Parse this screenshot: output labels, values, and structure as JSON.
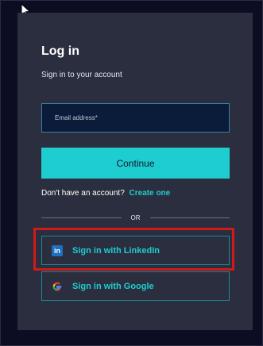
{
  "login": {
    "title": "Log in",
    "subtitle": "Sign in to your account",
    "email_placeholder": "Email address*",
    "email_value": "",
    "continue_label": "Continue",
    "no_account_text": "Don't have an account?",
    "create_link": "Create one",
    "divider_text": "OR"
  },
  "social": {
    "linkedin_label": "Sign in with LinkedIn",
    "google_label": "Sign in with Google",
    "linkedin_icon": "li-icon",
    "google_icon": "google-g-icon"
  },
  "colors": {
    "page_bg": "#0c0c22",
    "card_bg": "#2b2e3e",
    "accent": "#1ecdd0",
    "highlight": "#d11a1a"
  }
}
